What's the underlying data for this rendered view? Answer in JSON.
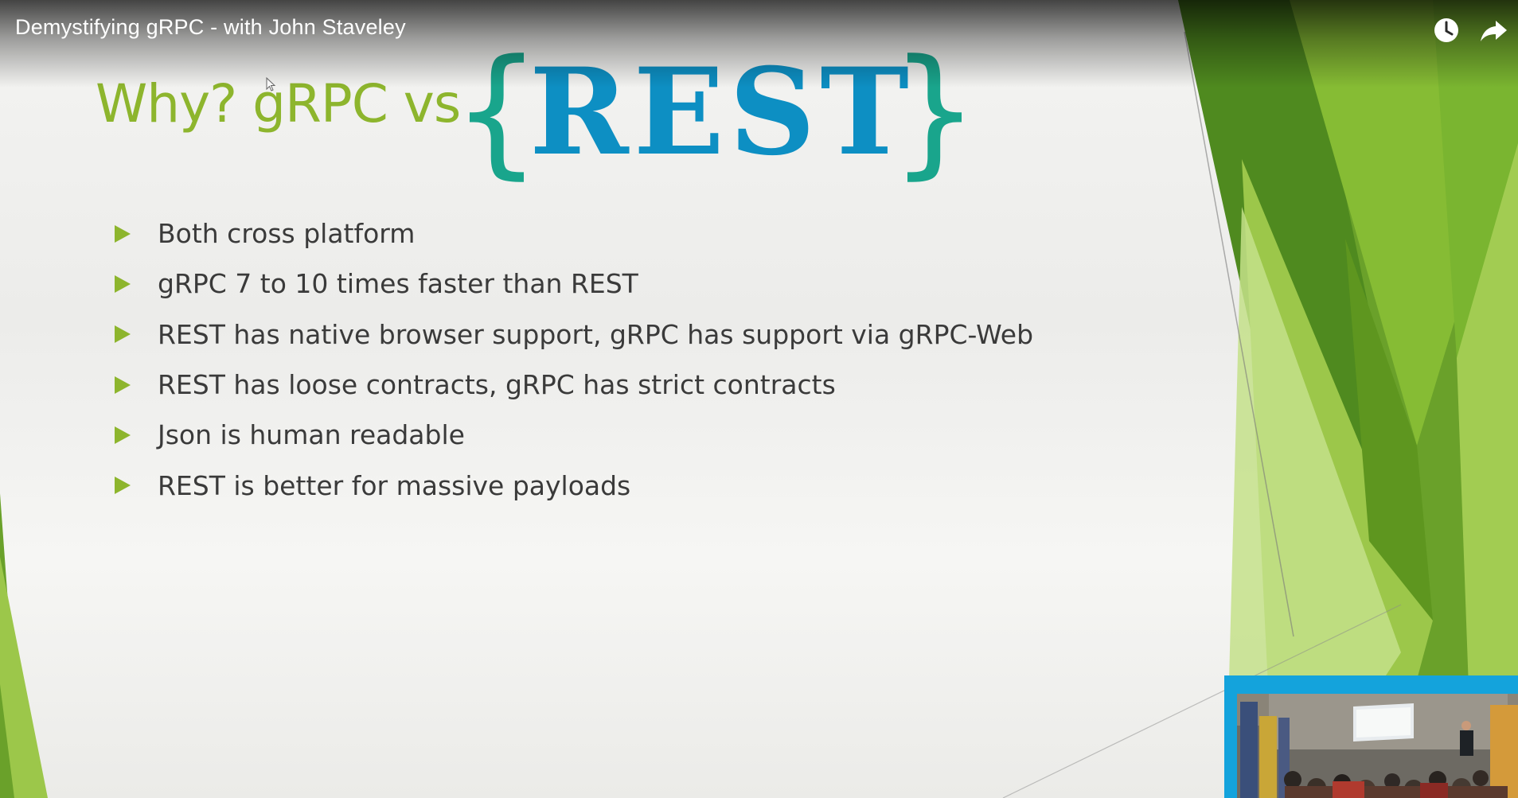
{
  "player": {
    "video_title": "Demystifying gRPC - with John Staveley",
    "icons": {
      "watch_later": "clock-icon",
      "share": "share-arrow-icon"
    }
  },
  "slide": {
    "title_prefix": "Why? gRPC vs",
    "logo": {
      "brace_open": "{",
      "text": "REST",
      "brace_close": "}"
    },
    "bullets": [
      "Both cross platform",
      "gRPC 7 to 10 times faster than REST",
      "REST has native browser support, gRPC has support via gRPC-Web",
      "REST has loose contracts, gRPC has strict contracts",
      "Json is human readable",
      "REST is better for massive payloads"
    ]
  },
  "colors": {
    "title_green": "#8db52d",
    "rest_blue": "#0d8fc3",
    "brace_teal": "#19a58c",
    "bullet_text": "#3a3a3a",
    "pip_border": "#14a3dc"
  }
}
